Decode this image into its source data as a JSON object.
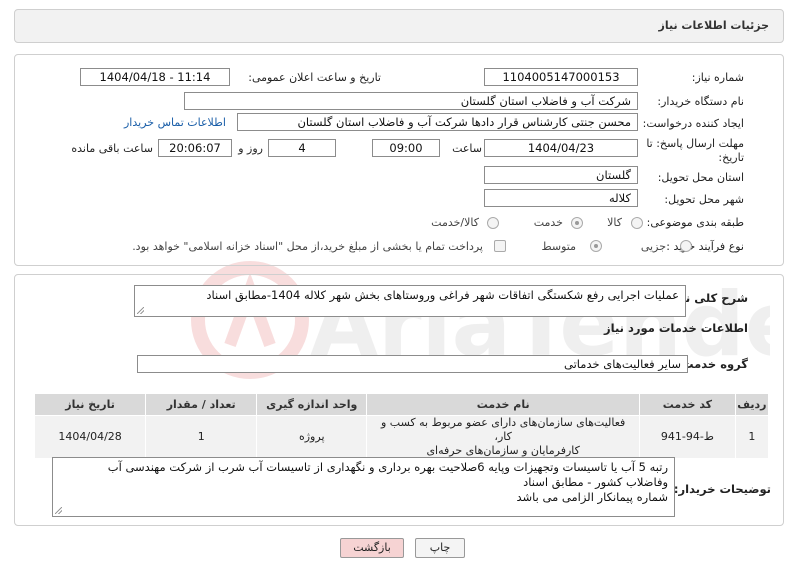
{
  "header": {
    "title": "جزئیات اطلاعات نیاز"
  },
  "form": {
    "need_number_label": "شماره نیاز:",
    "need_number": "1104005147000153",
    "announce_label": "تاریخ و ساعت اعلان عمومی:",
    "announce_value": "1404/04/18 - 11:14",
    "buyer_org_label": "نام دستگاه خریدار:",
    "buyer_org": "شرکت آب و فاضلاب استان گلستان",
    "creator_label": "ایجاد کننده درخواست:",
    "creator": "محسن جنتی کارشناس قرار دادها شرکت آب و فاضلاب استان گلستان",
    "contact_link": "اطلاعات تماس خریدار",
    "deadline_label_1": "مهلت ارسال پاسخ: تا",
    "deadline_label_2": "تاریخ:",
    "deadline_date": "1404/04/23",
    "time_label": "ساعت",
    "deadline_time": "09:00",
    "days_value": "4",
    "days_label": "روز و",
    "remaining_time": "20:06:07",
    "remaining_label": "ساعت باقی مانده",
    "province_label": "استان محل تحویل:",
    "province": "گلستان",
    "city_label": "شهر محل تحویل:",
    "city": "کلاله",
    "category_label": "طبقه بندی موضوعی:",
    "category_options": [
      "کالا",
      "خدمت",
      "کالا/خدمت"
    ],
    "category_selected": "خدمت",
    "process_label": "نوع فرآیند خرید :",
    "process_options": [
      "جزیی",
      "متوسط"
    ],
    "process_selected": "جزیی",
    "payment_note": "پرداخت تمام یا بخشی از مبلغ خرید،از محل \"اسناد خزانه اسلامی\" خواهد بود."
  },
  "details": {
    "summary_label": "شرح کلی نیاز:",
    "summary": "عملیات اجرایی رفع شکستگی اتفاقات شهر فراغی وروستاهای بخش شهر کلاله 1404-مطابق اسناد",
    "services_title": "اطلاعات خدمات مورد نیاز",
    "service_group_label": "گروه خدمت:",
    "service_group": "سایر فعالیت‌های خدماتی",
    "table": {
      "headers": [
        "ردیف",
        "کد خدمت",
        "نام خدمت",
        "واحد اندازه گیری",
        "تعداد / مقدار",
        "تاریخ نیاز"
      ],
      "rows": [
        {
          "index": "1",
          "code": "ط-94-941",
          "name_line1": "فعالیت‌های سازمان‌های دارای عضو مربوط به کسب و کار،",
          "name_line2": "کارفرمایان و سازمان‌های حرفه‌ای",
          "unit": "پروژه",
          "qty": "1",
          "date": "1404/04/28"
        }
      ]
    },
    "buyer_notes_label": "توضیحات خریدار:",
    "buyer_notes_line1": "رتبه 5 آب یا تاسیسات وتجهیزات وپایه 6صلاحیت بهره برداری و نگهداری از تاسیسات آب شرب از شرکت مهندسی آب",
    "buyer_notes_line2": "وفاضلاب کشور - مطابق اسناد",
    "buyer_notes_line3": "شماره پیمانکار الزامی می باشد"
  },
  "buttons": {
    "print": "چاپ",
    "back": "بازگشت"
  },
  "watermark": {
    "text": "AriaTender.neT"
  },
  "colors": {
    "link": "#1a5ea8",
    "back_button": "#f6d3d3",
    "print_button": "#f4f4f4"
  }
}
